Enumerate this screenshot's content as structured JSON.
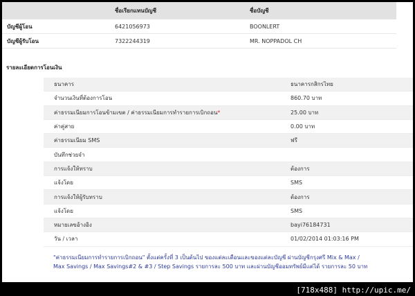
{
  "accounts": {
    "header": {
      "col1": "ชื่อเรียกแทนบัญชี",
      "col2": "ชื่อบัญชี"
    },
    "rows": [
      {
        "label": "บัญชีผู้โอน",
        "number": "6421056973",
        "name": "BOONLERT"
      },
      {
        "label": "บัญชีผู้รับโอน",
        "number": "7322244319",
        "name": "MR. NOPPADOL CH"
      }
    ]
  },
  "details": {
    "title": "รายละเอียดการโอนเงิน",
    "rows": [
      {
        "label": "ธนาคาร",
        "value": "ธนาคารกสิกรไทย"
      },
      {
        "label": "จำนวนเงินที่ต้องการโอน",
        "value": "860.70 บาท"
      },
      {
        "label": "ค่าธรรมเนียมการโอนข้ามเขต / ค่าธรรมเนียมการทำรายการเบิกถอน",
        "asterisk": "*",
        "value": "25.00 บาท"
      },
      {
        "label": "ค่าคู่สาย",
        "value": "0.00 บาท"
      },
      {
        "label": "ค่าธรรมเนียม SMS",
        "value": "ฟรี"
      },
      {
        "label": "บันทึกช่วยจำ",
        "value": ""
      },
      {
        "label": "การแจ้งให้ทราบ",
        "value": "ต้องการ"
      },
      {
        "label": "แจ้งโดย",
        "value": "SMS"
      },
      {
        "label": "การแจ้งให้ผู้รับทราบ",
        "value": "ต้องการ"
      },
      {
        "label": "แจ้งโดย",
        "value": "SMS"
      },
      {
        "label": "หมายเลขอ้างอิง",
        "value": "bayi76184731"
      },
      {
        "label": "วัน / เวลา",
        "value": "01/02/2014 01:03:16 PM"
      }
    ]
  },
  "note": {
    "text": "\"ค่าธรรมเนียมการทำรายการเบิกถอน\" ตั้งแต่ครั้งที่ 3 เป็นต้นไป ของแต่ละเดือนและของแต่ละบัญชี ผ่านบัญชีกรุงศรี Mix & Max / Max Savings / Max Savings#2 & #3 / Step Savings รายการละ 500 บาท และผ่านบัญชีออมทรัพย์มีแต่ได้ รายการละ 50 บาท"
  },
  "watermark": "[718x488] http://upic.me/"
}
